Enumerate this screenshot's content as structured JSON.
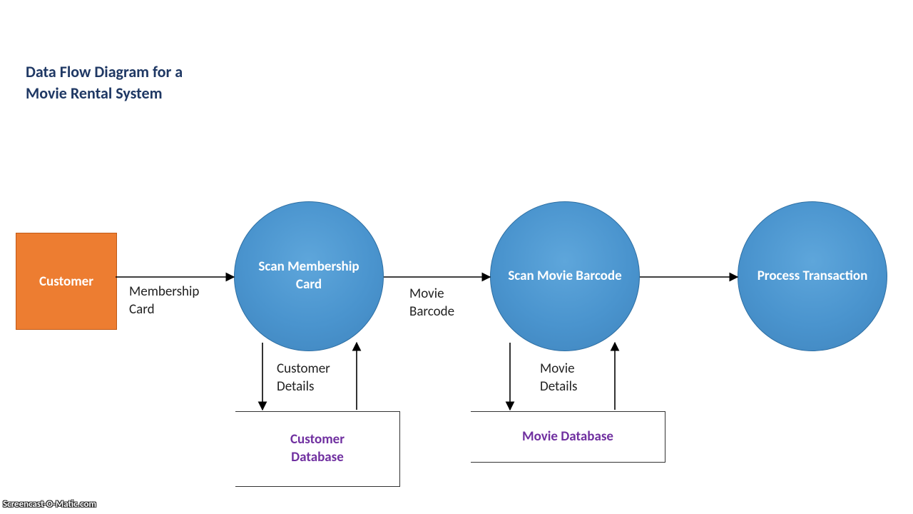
{
  "title": "Data Flow Diagram for a\nMovie Rental System",
  "entities": {
    "customer": "Customer"
  },
  "processes": {
    "scan_membership": "Scan Membership Card",
    "scan_barcode": "Scan Movie Barcode",
    "process_txn": "Process Transaction"
  },
  "datastores": {
    "customer_db": "Customer\nDatabase",
    "movie_db": "Movie Database"
  },
  "flows": {
    "membership_card": "Membership\nCard",
    "movie_barcode": "Movie\nBarcode",
    "customer_details": "Customer\nDetails",
    "movie_details": "Movie\nDetails"
  },
  "watermark": "Screencast-O-Matic.com"
}
